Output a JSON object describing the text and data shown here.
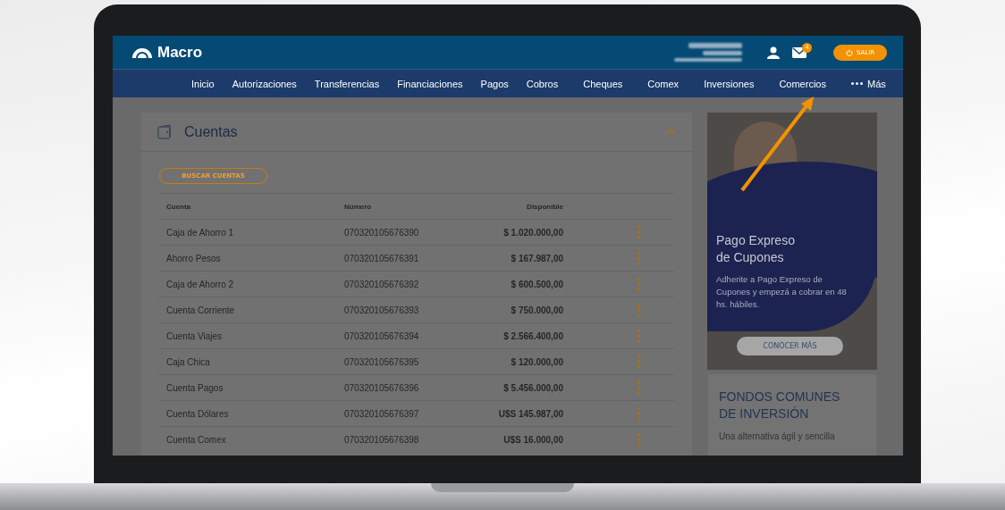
{
  "header": {
    "logo": "Macro",
    "mail_badge": "4",
    "logout": "SALIR"
  },
  "nav": {
    "items": [
      {
        "label": "Inicio",
        "kind": "link"
      },
      {
        "label": "Autorizaciones",
        "kind": "link"
      },
      {
        "label": "Transferencias",
        "kind": "link"
      },
      {
        "label": "Financiaciones",
        "kind": "link"
      },
      {
        "label": "Pagos",
        "kind": "link"
      },
      {
        "label": "Cobros",
        "kind": "link"
      },
      {
        "label": "Cheques",
        "kind": "link"
      },
      {
        "label": "Comex",
        "kind": "link"
      },
      {
        "label": "Inversiones",
        "kind": "link"
      },
      {
        "label": "Comercios",
        "kind": "link"
      },
      {
        "label": "Más",
        "kind": "more"
      }
    ]
  },
  "accounts": {
    "title": "Cuentas",
    "search_button": "BUSCAR CUENTAS",
    "columns": [
      "Cuenta",
      "Número",
      "Disponible"
    ],
    "rows": [
      {
        "name": "Caja de Ahorro 1",
        "number": "070320105676390",
        "available": "$ 1.020.000,00"
      },
      {
        "name": "Ahorro Pesos",
        "number": "070320105676391",
        "available": "$ 167.987,00"
      },
      {
        "name": "Caja de Ahorro 2",
        "number": "070320105676392",
        "available": "$ 600.500,00"
      },
      {
        "name": "Cuenta Corriente",
        "number": "070320105676393",
        "available": "$ 750.000,00"
      },
      {
        "name": "Cuenta Viajes",
        "number": "070320105676394",
        "available": "$ 2.566.400,00"
      },
      {
        "name": "Caja Chica",
        "number": "070320105676395",
        "available": "$ 120.000,00"
      },
      {
        "name": "Cuenta Pagos",
        "number": "070320105676396",
        "available": "$ 5.456.000,00"
      },
      {
        "name": "Cuenta Dólares",
        "number": "070320105676397",
        "available": "U$S 145.987,00"
      },
      {
        "name": "Cuenta Comex",
        "number": "070320105676398",
        "available": "U$S 16.000,00"
      }
    ]
  },
  "promo": {
    "title_lines": [
      "Pago Expreso",
      "de Cupones"
    ],
    "text": "Adherite a Pago Expreso de Cupones y empezá a cobrar en 48 hs. hábiles.",
    "button": "CONOCER MÁS"
  },
  "funds": {
    "title_lines": [
      "FONDOS COMUNES",
      "DE INVERSIÓN"
    ],
    "text": "Una alternativa ágil y sencilla"
  }
}
